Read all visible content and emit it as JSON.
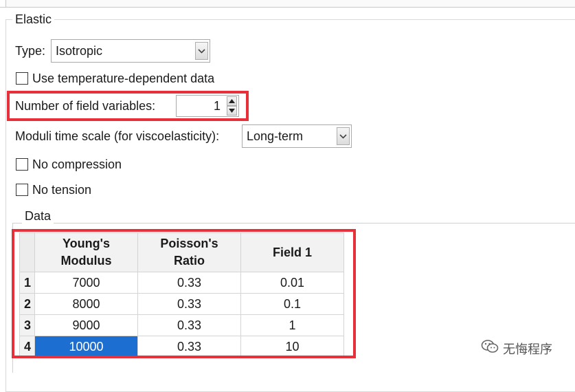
{
  "section": {
    "title": "Elastic"
  },
  "type_field": {
    "label": "Type:",
    "value": "Isotropic"
  },
  "temperature_checkbox": {
    "label": "Use temperature-dependent data",
    "checked": false
  },
  "field_variables": {
    "label": "Number of field variables:",
    "value": "1"
  },
  "moduli_time_scale": {
    "label": "Moduli time scale (for viscoelasticity):",
    "value": "Long-term"
  },
  "no_compression": {
    "label": "No compression",
    "checked": false
  },
  "no_tension": {
    "label": "No tension",
    "checked": false
  },
  "data_group": {
    "title": "Data",
    "columns": [
      "Young's\nModulus",
      "Poisson's\nRatio",
      "Field 1"
    ],
    "rows": [
      {
        "index": "1",
        "cells": [
          "7000",
          "0.33",
          "0.01"
        ]
      },
      {
        "index": "2",
        "cells": [
          "8000",
          "0.33",
          "0.1"
        ]
      },
      {
        "index": "3",
        "cells": [
          "9000",
          "0.33",
          "1"
        ]
      },
      {
        "index": "4",
        "cells": [
          "10000",
          "0.33",
          "10"
        ]
      }
    ],
    "selected_cell": "rows.3.cells.0"
  },
  "highlight_color": "#e8303a",
  "selection_color": "#1c6fd1",
  "watermark": {
    "icon": "wechat-icon",
    "text": "无悔程序"
  }
}
